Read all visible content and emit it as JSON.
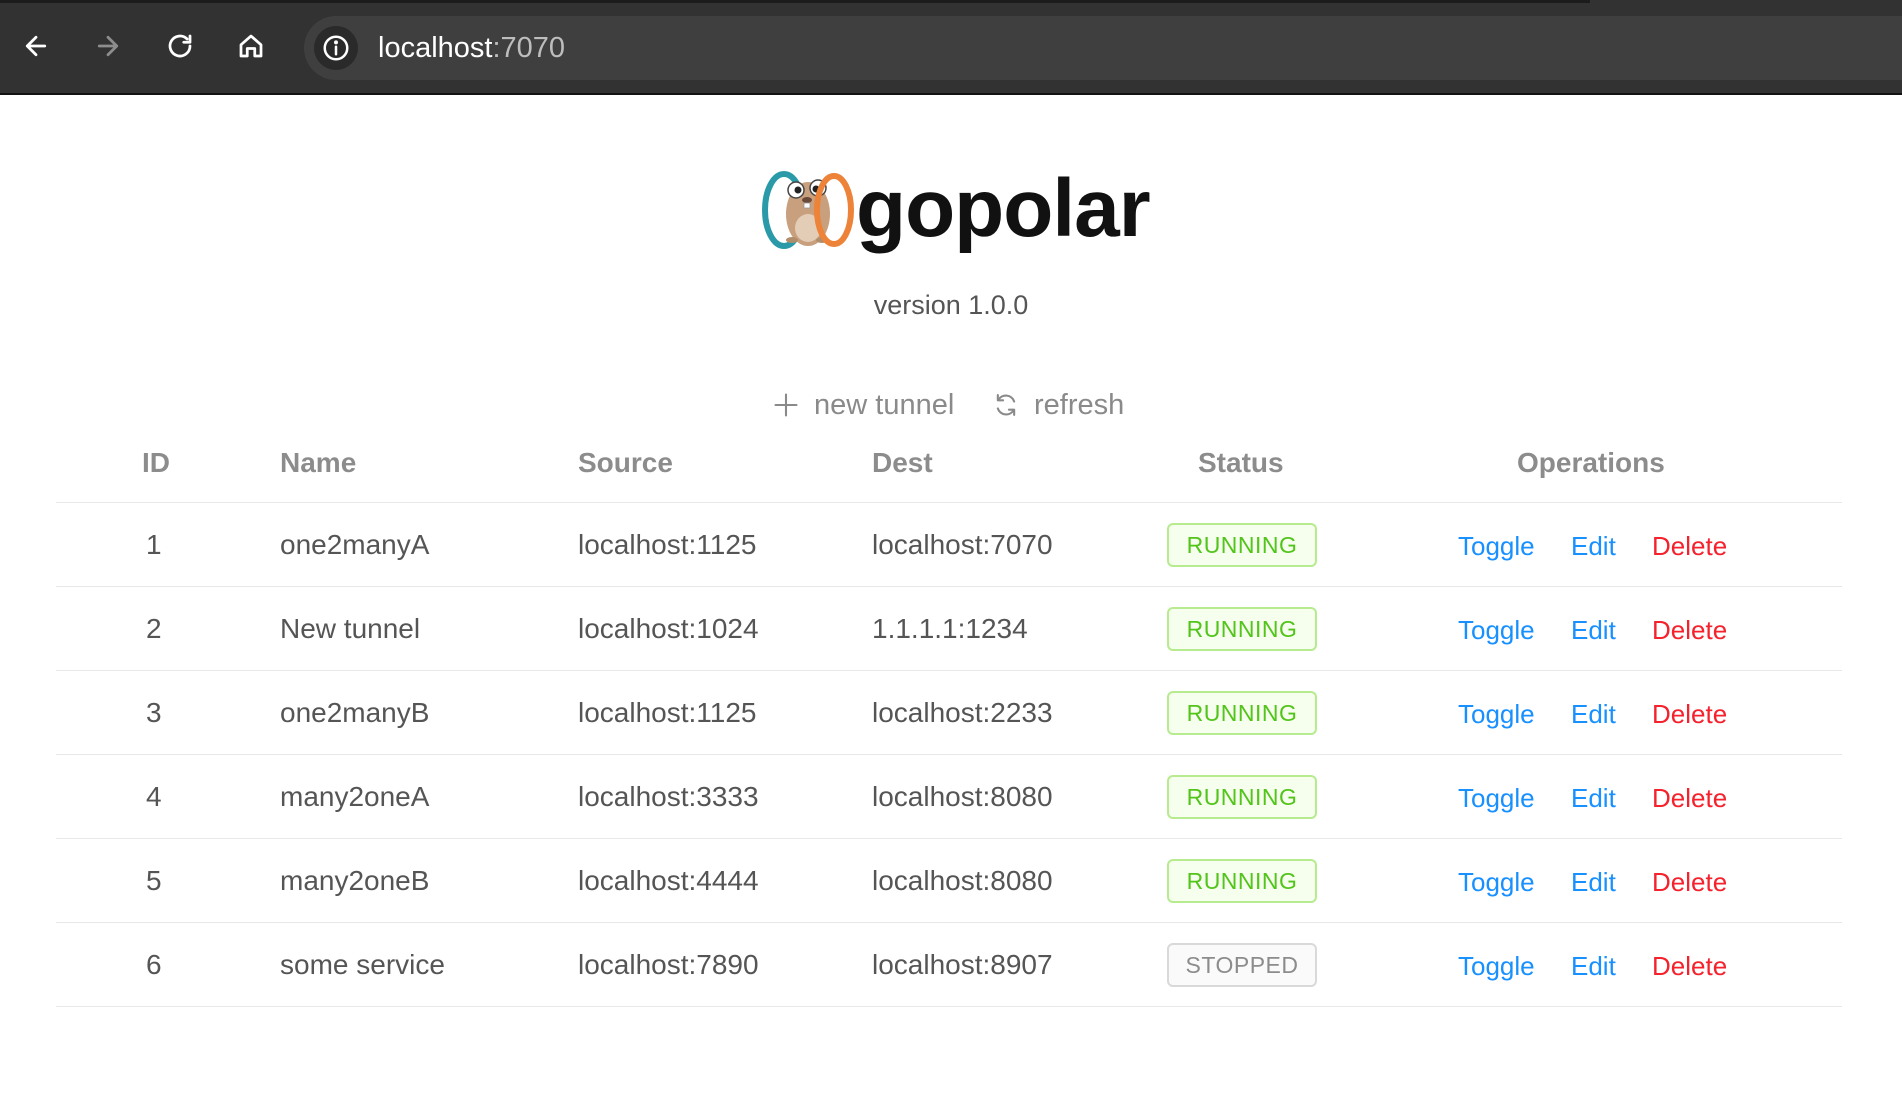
{
  "browser": {
    "url_host": "localhost",
    "url_port": ":7070"
  },
  "header": {
    "brand": "gopolar",
    "version": "version 1.0.0"
  },
  "actions": {
    "new_tunnel": "new tunnel",
    "refresh": "refresh"
  },
  "table": {
    "columns": {
      "id": "ID",
      "name": "Name",
      "source": "Source",
      "dest": "Dest",
      "status": "Status",
      "operations": "Operations"
    },
    "rows": [
      {
        "id": "1",
        "name": "one2manyA",
        "source": "localhost:1125",
        "dest": "localhost:7070",
        "status": "RUNNING"
      },
      {
        "id": "2",
        "name": "New tunnel",
        "source": "localhost:1024",
        "dest": "1.1.1.1:1234",
        "status": "RUNNING"
      },
      {
        "id": "3",
        "name": "one2manyB",
        "source": "localhost:1125",
        "dest": "localhost:2233",
        "status": "RUNNING"
      },
      {
        "id": "4",
        "name": "many2oneA",
        "source": "localhost:3333",
        "dest": "localhost:8080",
        "status": "RUNNING"
      },
      {
        "id": "5",
        "name": "many2oneB",
        "source": "localhost:4444",
        "dest": "localhost:8080",
        "status": "RUNNING"
      },
      {
        "id": "6",
        "name": "some service",
        "source": "localhost:7890",
        "dest": "localhost:8907",
        "status": "STOPPED"
      }
    ],
    "ops": {
      "toggle": "Toggle",
      "edit": "Edit",
      "delete": "Delete"
    }
  },
  "colors": {
    "running": "#52c41a",
    "stopped": "#8c8c8c",
    "link": "#1890ff",
    "danger": "#f5222d"
  }
}
